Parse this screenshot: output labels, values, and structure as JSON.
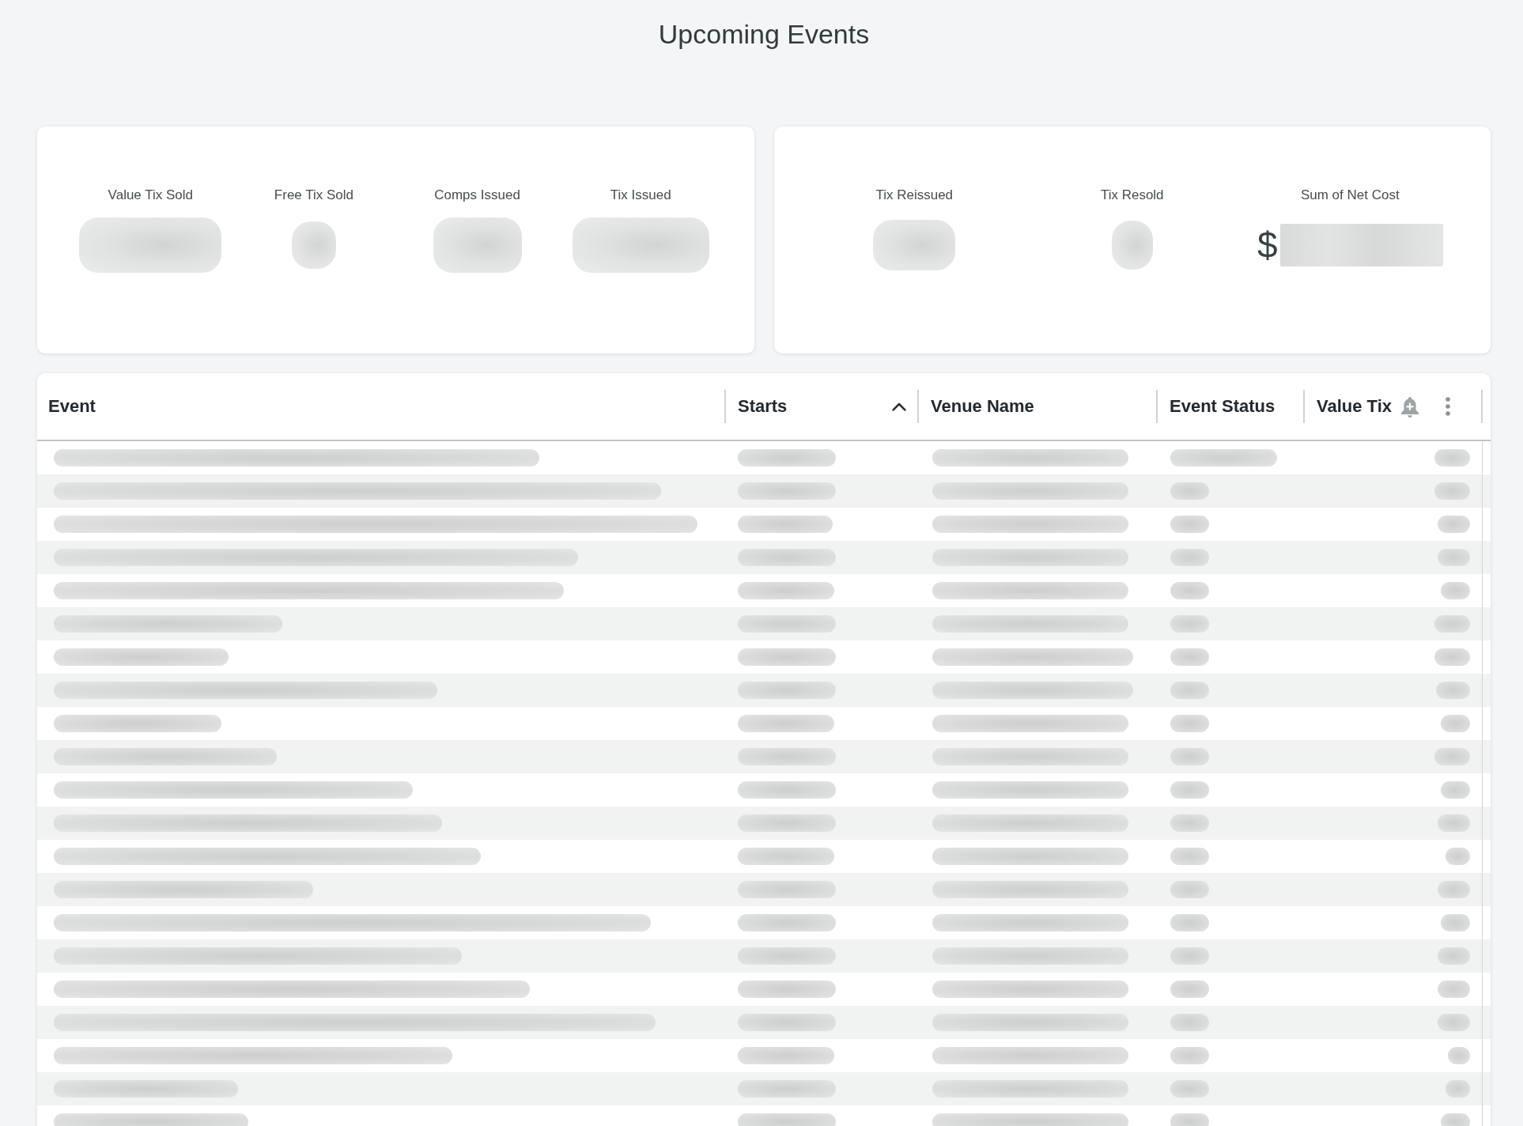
{
  "page": {
    "title": "Upcoming Events"
  },
  "stat_cards": [
    {
      "stats": [
        {
          "label": "Value Tix Sold",
          "kind": "blurred"
        },
        {
          "label": "Free Tix Sold",
          "kind": "blurred"
        },
        {
          "label": "Comps Issued",
          "kind": "blurred"
        },
        {
          "label": "Tix Issued",
          "kind": "blurred"
        }
      ]
    },
    {
      "stats": [
        {
          "label": "Tix Reissued",
          "kind": "blurred"
        },
        {
          "label": "Tix Resold",
          "kind": "blurred"
        },
        {
          "label": "Sum of Net Cost",
          "prefix": "$",
          "kind": "blurred"
        }
      ]
    }
  ],
  "table": {
    "columns": [
      {
        "label": "Event",
        "sorted": false,
        "hovered": false
      },
      {
        "label": "Starts",
        "sorted": true,
        "hovered": false
      },
      {
        "label": "Venue Name",
        "sorted": false,
        "hovered": false
      },
      {
        "label": "Event Status",
        "sorted": false,
        "hovered": false
      },
      {
        "label": "Value Tix",
        "sorted": false,
        "hovered": true
      }
    ],
    "rows": [
      {
        "kind": "blurred"
      },
      {
        "kind": "blurred"
      },
      {
        "kind": "blurred"
      },
      {
        "kind": "blurred"
      },
      {
        "kind": "blurred"
      },
      {
        "kind": "blurred"
      },
      {
        "kind": "blurred"
      },
      {
        "kind": "blurred"
      },
      {
        "kind": "blurred"
      },
      {
        "kind": "blurred"
      },
      {
        "kind": "blurred"
      },
      {
        "kind": "blurred"
      },
      {
        "kind": "blurred"
      },
      {
        "kind": "blurred"
      },
      {
        "kind": "blurred"
      },
      {
        "kind": "blurred"
      },
      {
        "kind": "blurred"
      },
      {
        "kind": "blurred"
      },
      {
        "kind": "blurred"
      },
      {
        "kind": "blurred"
      },
      {
        "kind": "blurred"
      }
    ]
  }
}
